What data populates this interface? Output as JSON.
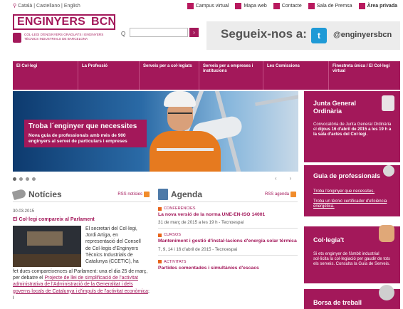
{
  "lang": "Català | Castellano | English",
  "toplinks": [
    "Campus virtual",
    "Mapa web",
    "Contacte",
    "Sala de Premsa",
    "Àrea privada"
  ],
  "logo": {
    "word1": "ENGINYERS",
    "word2": "BCN",
    "sub": "COL·LEGI D'ENGINYERS GRADUATS I ENGINYERS TÈCNICS INDUSTRIALS DE BARCELONA"
  },
  "search": {
    "placeholder": "",
    "button": "›"
  },
  "follow": {
    "text": "Segueix-nos a:",
    "handle": "@enginyersbcn"
  },
  "nav": [
    "El Col·legi",
    "La Professió",
    "Serveis per a col·legiats",
    "Serveis per a empreses i institucions",
    "Les Comissions",
    "Finestreta única / El Col·legi virtual"
  ],
  "hero": {
    "title": "Troba l´enginyer que necessites",
    "desc": "Nova guia de professionals amb més de 900 enginyers al servei de particulars i empreses"
  },
  "slider": {
    "prev": "‹",
    "next": "›"
  },
  "noticies": {
    "title": "Notícies",
    "rss": "RSS notícies",
    "date": "30.03.2015",
    "headline": "El Col·legi compareix al Parlament",
    "body_lines": [
      "El secretari del Col·legi,",
      "Jordi Artiga, en",
      "representació del Consell",
      "de Col·legis d'Enginyers",
      "Tècnics Industrials de",
      "Catalunya (CCETIC), ha"
    ],
    "body_rest_1": "fet dues compareixences al Parlament: una el dia 25 de març, per debatre el ",
    "body_link": "Projecte de llei de simplificació de l'activitat administrativa de l'Administració de la Generalitat i dels governs locals de Catalunya i d'impuls de l'activitat econòmica",
    "body_rest_2": "; i"
  },
  "agenda": {
    "title": "Agenda",
    "rss": "RSS agenda",
    "items": [
      {
        "cat": "CONFERÈNCIES",
        "title": "La nova versió de la norma UNE-EN-ISO 14001",
        "date": "31 de març de 2015 a les 19 h - Tecnoespai"
      },
      {
        "cat": "CURSOS",
        "title": "Manteniment i gestió d'instal·lacions d'energia solar tèrmica",
        "date": "7, 9, 14 i 16 d'abril de 2015 - Tecnoespai"
      },
      {
        "cat": "ACTIVITATS",
        "title": "Partides comentades i simultànies d'escacs",
        "date": ""
      }
    ]
  },
  "side": {
    "junta_title": "Junta General Ordinària",
    "junta_body_1": "Convocatòria de Junta General Ordinària el ",
    "junta_body_bold": "dijous 16 d'abril de 2015 a les 19 h a la sala d'actes del Col·legi.",
    "guia_title": "Guia de professionals",
    "guia_link1": "Troba l'enginyer que necessites.",
    "guia_link2": "Troba un tècnic certificador d'eficiència energètica.",
    "col_title": "Col·legia't",
    "col_body": "Si ets enginyer de l'àmbit industrial sol·licita la col·legiació per gaudir de tots els serveis. Consulta la Guia de Serveis.",
    "borsa_title": "Borsa de treball"
  },
  "colors": {
    "brand": "#a3185a",
    "rss": "#f18c2b",
    "twitter": "#1f9ad6"
  },
  "icons": [
    "location-pin-icon",
    "search-icon",
    "twitter-icon",
    "rss-icon",
    "megaphone-icon",
    "book-icon",
    "seal-icon",
    "magnifier-icon",
    "thumbs-up-icon",
    "gear-icon"
  ]
}
